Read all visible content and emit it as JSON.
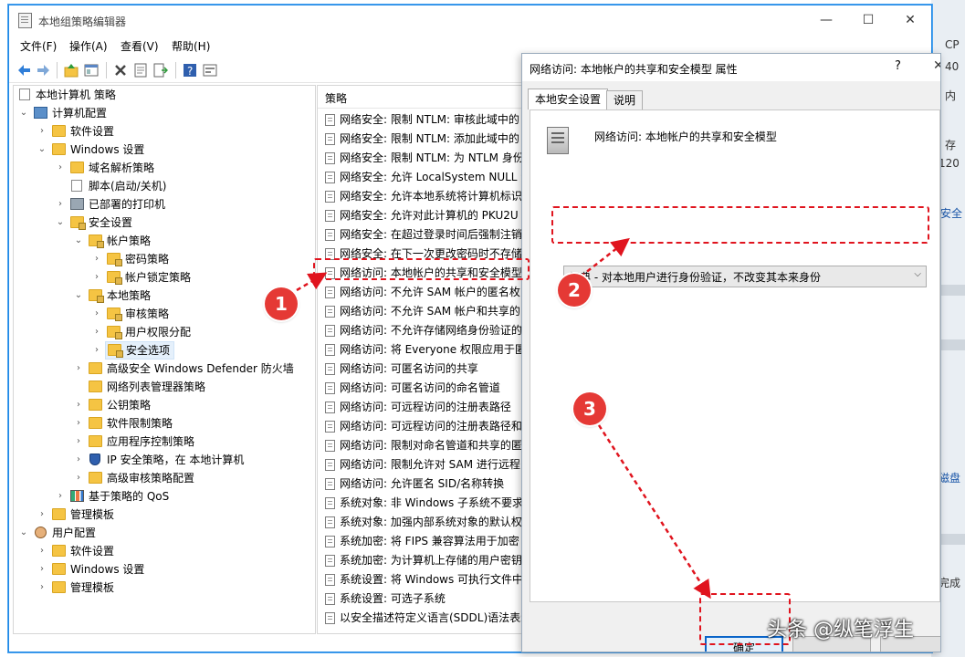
{
  "window": {
    "title": "本地组策略编辑器",
    "minimize": "—",
    "maximize": "☐",
    "close": "✕"
  },
  "menu": [
    "文件(F)",
    "操作(A)",
    "查看(V)",
    "帮助(H)"
  ],
  "tree": {
    "items": [
      {
        "label": "本地计算机 策略",
        "icon": "policy-icon"
      },
      {
        "label": "计算机配置",
        "icon": "computer-icon"
      },
      {
        "label": "软件设置",
        "icon": "folder-icon"
      },
      {
        "label": "Windows 设置",
        "icon": "folder-icon"
      },
      {
        "label": "域名解析策略",
        "icon": "folder-icon"
      },
      {
        "label": "脚本(启动/关机)",
        "icon": "script-icon"
      },
      {
        "label": "已部署的打印机",
        "icon": "printer-icon"
      },
      {
        "label": "安全设置",
        "icon": "security-folder-icon"
      },
      {
        "label": "帐户策略",
        "icon": "security-folder-icon"
      },
      {
        "label": "密码策略",
        "icon": "security-folder-icon"
      },
      {
        "label": "帐户锁定策略",
        "icon": "security-folder-icon"
      },
      {
        "label": "本地策略",
        "icon": "security-folder-icon"
      },
      {
        "label": "审核策略",
        "icon": "security-folder-icon"
      },
      {
        "label": "用户权限分配",
        "icon": "security-folder-icon"
      },
      {
        "label": "安全选项",
        "icon": "security-folder-icon"
      },
      {
        "label": "高级安全 Windows Defender 防火墙",
        "icon": "folder-icon"
      },
      {
        "label": "网络列表管理器策略",
        "icon": "folder-icon"
      },
      {
        "label": "公钥策略",
        "icon": "folder-icon"
      },
      {
        "label": "软件限制策略",
        "icon": "folder-icon"
      },
      {
        "label": "应用程序控制策略",
        "icon": "folder-icon"
      },
      {
        "label": "IP 安全策略，在 本地计算机",
        "icon": "shield-icon"
      },
      {
        "label": "高级审核策略配置",
        "icon": "folder-icon"
      },
      {
        "label": "基于策略的 QoS",
        "icon": "qos-icon"
      },
      {
        "label": "管理模板",
        "icon": "folder-icon"
      },
      {
        "label": "用户配置",
        "icon": "user-icon"
      },
      {
        "label": "软件设置",
        "icon": "folder-icon"
      },
      {
        "label": "Windows 设置",
        "icon": "folder-icon"
      },
      {
        "label": "管理模板",
        "icon": "folder-icon"
      }
    ]
  },
  "list": {
    "header": "策略",
    "rows": [
      "网络安全: 限制 NTLM: 审核此域中的",
      "网络安全: 限制 NTLM: 添加此域中的",
      "网络安全: 限制 NTLM: 为 NTLM 身份",
      "网络安全: 允许 LocalSystem NULL 会",
      "网络安全: 允许本地系统将计算机标识",
      "网络安全: 允许对此计算机的 PKU2U",
      "网络安全: 在超过登录时间后强制注销",
      "网络安全: 在下一次更改密码时不存储",
      "网络访问: 本地帐户的共享和安全模型",
      "网络访问: 不允许 SAM 帐户的匿名枚",
      "网络访问: 不允许 SAM 帐户和共享的",
      "网络访问: 不允许存储网络身份验证的",
      "网络访问: 将 Everyone 权限应用于匿",
      "网络访问: 可匿名访问的共享",
      "网络访问: 可匿名访问的命名管道",
      "网络访问: 可远程访问的注册表路径",
      "网络访问: 可远程访问的注册表路径和",
      "网络访问: 限制对命名管道和共享的匿",
      "网络访问: 限制允许对 SAM 进行远程",
      "网络访问: 允许匿名 SID/名称转换",
      "系统对象: 非 Windows 子系统不要求",
      "系统对象: 加强内部系统对象的默认权",
      "系统加密: 将 FIPS 兼容算法用于加密",
      "系统加密: 为计算机上存储的用户密钥",
      "系统设置: 将 Windows 可执行文件中",
      "系统设置: 可选子系统",
      "以安全描述符定义语言(SDDL)语法表示"
    ]
  },
  "dialog": {
    "title": "网络访问: 本地帐户的共享和安全模型 属性",
    "help": "?",
    "close": "✕",
    "tabs": [
      "本地安全设置",
      "说明"
    ],
    "policy_name": "网络访问: 本地帐户的共享和安全模型",
    "dropdown_value": "经典 - 对本地用户进行身份验证，不改变其本来身份",
    "ok": "确定"
  },
  "background": {
    "texts": [
      "CP",
      "40",
      "内",
      "存",
      "120",
      "安全",
      "磁盘",
      "完成"
    ]
  },
  "annotations": [
    "1",
    "2",
    "3"
  ],
  "watermark": "头条 @纵笔浮生",
  "colors": {
    "accent": "#1e88e5",
    "annotation": "#e53935",
    "selection": "#e5f0fb"
  }
}
